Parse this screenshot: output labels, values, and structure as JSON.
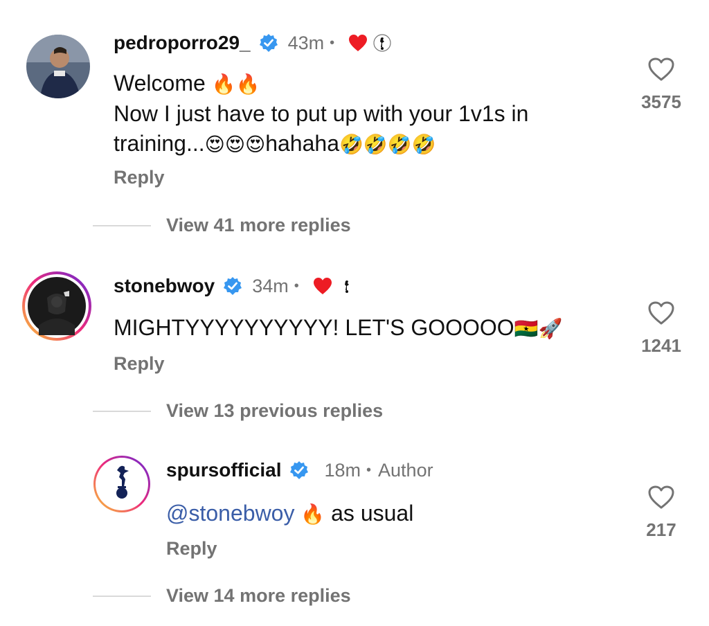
{
  "comments": [
    {
      "username": "pedroporro29_",
      "time": "43m",
      "dot": "•",
      "text_lines": [
        "Welcome ",
        "Now I just have to put up with your 1v1s in",
        "training..."
      ],
      "line1_emojis": "🔥🔥",
      "line3_emojis1": "😍😍😍",
      "line3_word": "hahaha",
      "line3_emojis2": "🤣🤣🤣🤣",
      "reply_label": "Reply",
      "likes": "3575",
      "view_more": "View 41 more replies"
    },
    {
      "username": "stonebwoy",
      "time": "34m",
      "dot": "•",
      "text": "MIGHTYYYYYYYYYY! LET'S GOOOOO",
      "emojis": "🇬🇭🚀",
      "reply_label": "Reply",
      "likes": "1241",
      "view_more": "View 13 previous replies"
    },
    {
      "username": "spursofficial",
      "time": "18m",
      "dot": "•",
      "author_label": "Author",
      "mention": "@stonebwoy",
      "emoji": "🔥",
      "text": "as usual",
      "reply_label": "Reply",
      "likes": "217",
      "view_more": "View 14 more replies"
    }
  ],
  "colors": {
    "verified": "#3797f0",
    "heart": "#ed1c24",
    "muted": "#737373",
    "mention": "#3b5ea8",
    "story_ring_start": "#f9ce34",
    "story_ring_mid": "#ee2a7b",
    "story_ring_end": "#6228d7"
  }
}
